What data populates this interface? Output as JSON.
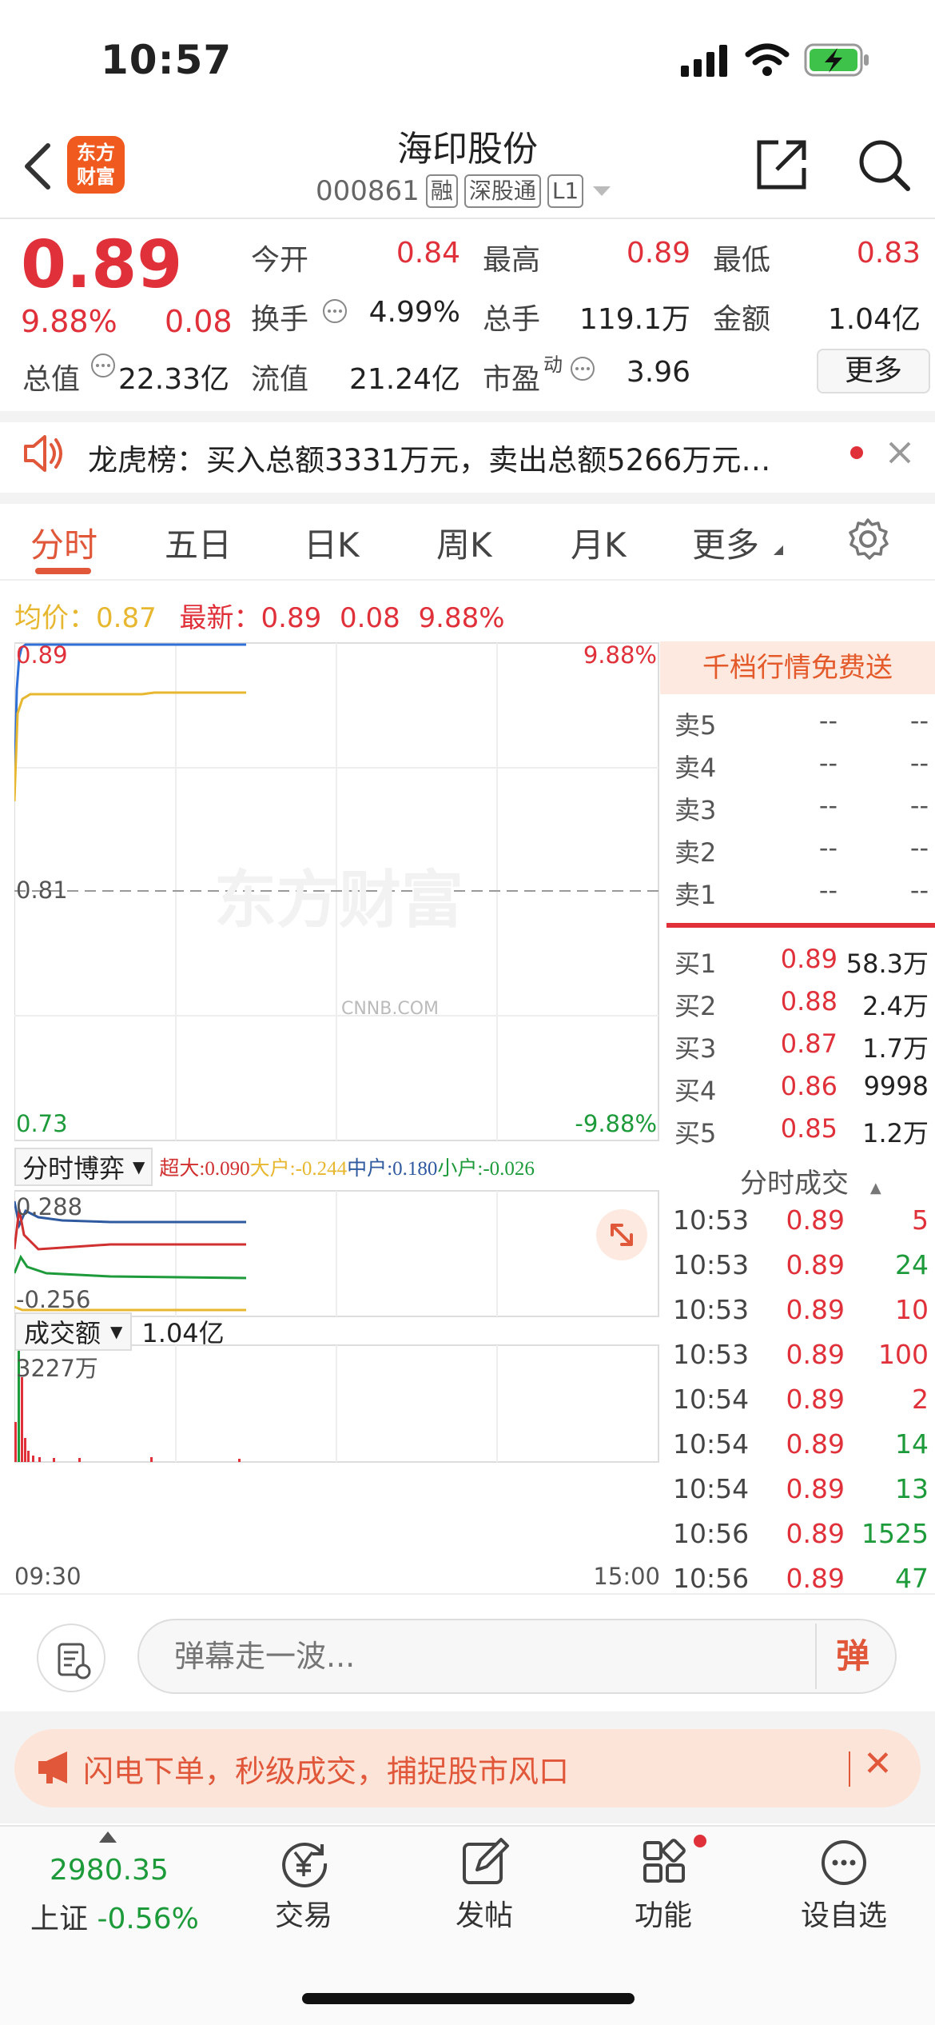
{
  "status": {
    "time": "10:57"
  },
  "header": {
    "title": "海印股份",
    "code": "000861",
    "tags": [
      "融",
      "深股通",
      "L1"
    ],
    "logo_text": [
      "东方",
      "财富"
    ]
  },
  "quote": {
    "price": "0.89",
    "pct": "9.88%",
    "change": "0.08",
    "open_label": "今开",
    "open": "0.84",
    "high_label": "最高",
    "high": "0.89",
    "low_label": "最低",
    "low": "0.83",
    "turnover_label": "换手",
    "turnover": "4.99%",
    "volume_label": "总手",
    "volume": "119.1万",
    "amount_label": "金额",
    "amount": "1.04亿",
    "total_value_label": "总值",
    "total_value": "22.33亿",
    "float_value_label": "流值",
    "float_value": "21.24亿",
    "pe_label": "市盈",
    "pe_sup": "动",
    "pe": "3.96",
    "more_label": "更多"
  },
  "dragon_tiger": {
    "text": "龙虎榜：买入总额3331万元，卖出总额5266万元…"
  },
  "tabs": [
    "分时",
    "五日",
    "日K",
    "周K",
    "月K",
    "更多"
  ],
  "summary": {
    "avg_label": "均价：",
    "avg": "0.87",
    "latest_label": "最新：",
    "latest": "0.89",
    "latest_chg": "0.08",
    "latest_pct": "9.88%"
  },
  "chart": {
    "top_price": "0.89",
    "top_pct": "9.88%",
    "mid_price": "0.81",
    "bottom_price": "0.73",
    "bottom_pct": "-9.88%",
    "watermark": "东方财富",
    "watermark2": "CNNB.COM",
    "flow_selector": "分时博弈",
    "flow_super_label": "超大",
    "flow_super": ":0.090",
    "flow_big_label": "大户",
    "flow_big": ":-0.244",
    "flow_mid_label": "中户",
    "flow_mid": ":0.180",
    "flow_small_label": "小户",
    "flow_small": ":-0.026",
    "flow_top": "0.288",
    "flow_bottom": "-0.256",
    "vol_selector": "成交额",
    "vol_total": "1.04亿",
    "vol_top": "3227万",
    "time_start": "09:30",
    "time_end": "15:00"
  },
  "orderbook": {
    "promo": "千档行情免费送",
    "asks": [
      {
        "level": "卖5",
        "price": "--",
        "vol": "--"
      },
      {
        "level": "卖4",
        "price": "--",
        "vol": "--"
      },
      {
        "level": "卖3",
        "price": "--",
        "vol": "--"
      },
      {
        "level": "卖2",
        "price": "--",
        "vol": "--"
      },
      {
        "level": "卖1",
        "price": "--",
        "vol": "--"
      }
    ],
    "bids": [
      {
        "level": "买1",
        "price": "0.89",
        "vol": "58.3万"
      },
      {
        "level": "买2",
        "price": "0.88",
        "vol": "2.4万"
      },
      {
        "level": "买3",
        "price": "0.87",
        "vol": "1.7万"
      },
      {
        "level": "买4",
        "price": "0.86",
        "vol": "9998"
      },
      {
        "level": "买5",
        "price": "0.85",
        "vol": "1.2万"
      }
    ],
    "trades_title": "分时成交",
    "trades": [
      {
        "time": "10:53",
        "price": "0.89",
        "vol": "5"
      },
      {
        "time": "10:53",
        "price": "0.89",
        "vol": "24"
      },
      {
        "time": "10:53",
        "price": "0.89",
        "vol": "10"
      },
      {
        "time": "10:53",
        "price": "0.89",
        "vol": "100"
      },
      {
        "time": "10:54",
        "price": "0.89",
        "vol": "2"
      },
      {
        "time": "10:54",
        "price": "0.89",
        "vol": "14"
      },
      {
        "time": "10:54",
        "price": "0.89",
        "vol": "13"
      },
      {
        "time": "10:56",
        "price": "0.89",
        "vol": "1525"
      },
      {
        "time": "10:56",
        "price": "0.89",
        "vol": "47"
      }
    ]
  },
  "comment": {
    "placeholder": "弹幕走一波...",
    "danmu_btn": "弹"
  },
  "ad": {
    "text": "闪电下单，秒级成交，捕捉股市风口"
  },
  "tabbar": {
    "index_value": "2980.35",
    "index_name": "上证",
    "index_pct": "-0.56%",
    "items": [
      "交易",
      "发帖",
      "功能",
      "设自选"
    ]
  },
  "colors": {
    "up": "#e0303a",
    "down": "#1d9a3a",
    "accent": "#e0573a",
    "avg_line": "#e8b730",
    "price_line": "#2f6fd6"
  }
}
